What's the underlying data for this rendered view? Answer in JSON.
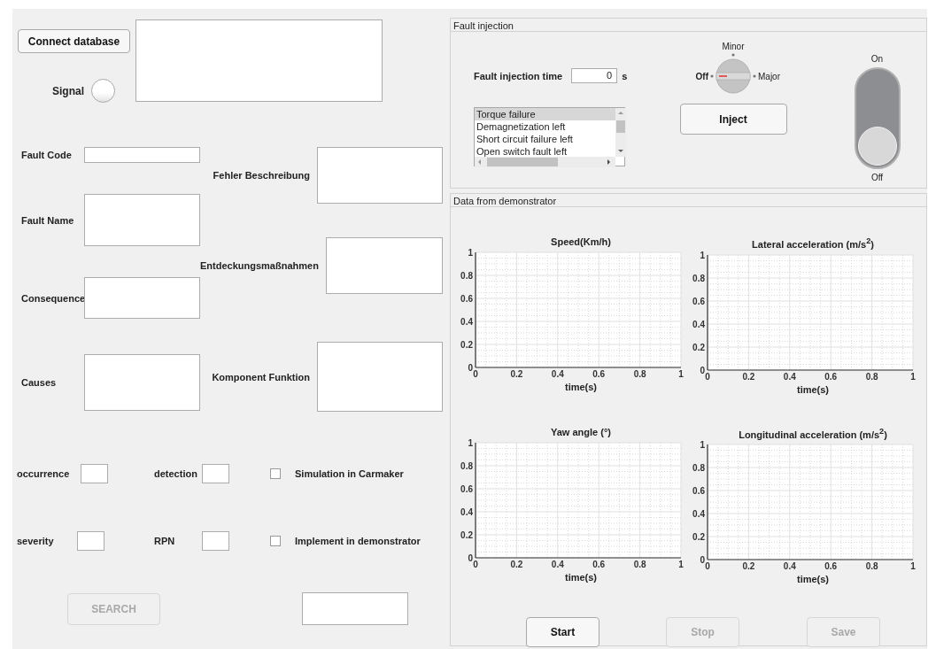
{
  "connect_button": {
    "label": "Connect database"
  },
  "signal": {
    "label": "Signal",
    "on": false
  },
  "fault_fields": [
    {
      "label": "Fault Code"
    },
    {
      "label": "Fault Name"
    },
    {
      "label": "Consequence"
    },
    {
      "label": "Causes"
    }
  ],
  "description_fields": [
    {
      "label": "Fehler Beschreibung"
    },
    {
      "label": "Entdeckungsmaßnahmen"
    },
    {
      "label": "Komponent Funktion"
    }
  ],
  "scores": [
    {
      "label": "occurrence"
    },
    {
      "label": "detection"
    },
    {
      "label": "severity"
    },
    {
      "label": "RPN"
    }
  ],
  "options": [
    {
      "label": "Simulation in Carmaker",
      "checked": false
    },
    {
      "label": "Implement in demonstrator",
      "checked": false
    }
  ],
  "search_button": {
    "label": "SEARCH",
    "disabled": true
  },
  "fault_injection": {
    "title": "Fault injection",
    "time_label": "Fault injection time",
    "time_value": "0",
    "time_unit": "s",
    "faults": [
      {
        "label": "Torque failure",
        "selected": true
      },
      {
        "label": "Demagnetization left",
        "selected": false
      },
      {
        "label": "Short circuit failure left",
        "selected": false
      },
      {
        "label": "Open switch fault left",
        "selected": false
      }
    ],
    "severity_knob": [
      {
        "label": "Off",
        "selected": true
      },
      {
        "label": "Minor",
        "selected": false
      },
      {
        "label": "Major",
        "selected": false
      }
    ],
    "inject_button": {
      "label": "Inject"
    },
    "switch": {
      "on_label": "On",
      "off_label": "Off",
      "on": false
    }
  },
  "data_panel": {
    "title": "Data from demonstrator",
    "charts": [
      {
        "chart_data": {
          "type": "line",
          "grid": true,
          "title": "Speed(Km/h)",
          "xlabel": "time(s)",
          "xlim": [
            0,
            1
          ],
          "ylim": [
            0,
            1
          ],
          "xticks": [
            0,
            0.2,
            0.4,
            0.6,
            0.8,
            1
          ],
          "yticks": [
            0,
            0.2,
            0.4,
            0.6,
            0.8,
            1
          ]
        }
      },
      {
        "chart_data": {
          "type": "line",
          "grid": true,
          "title": "Lateral  acceleration  (m/s$^{2}$)",
          "xlabel": "time(s)",
          "xlim": [
            0,
            1
          ],
          "ylim": [
            0,
            1
          ],
          "xticks": [
            0,
            0.2,
            0.4,
            0.6,
            0.8,
            1
          ],
          "yticks": [
            0,
            0.2,
            0.4,
            0.6,
            0.8,
            1
          ]
        }
      },
      {
        "chart_data": {
          "type": "line",
          "grid": true,
          "title": "Yaw angle (°)",
          "xlabel": "time(s)",
          "xlim": [
            0,
            1
          ],
          "ylim": [
            0,
            1
          ],
          "xticks": [
            0,
            0.2,
            0.4,
            0.6,
            0.8,
            1
          ],
          "yticks": [
            0,
            0.2,
            0.4,
            0.6,
            0.8,
            1
          ]
        }
      },
      {
        "chart_data": {
          "type": "line",
          "grid": true,
          "title": "Longitudinal  acceleration  (m/s$^{2}$)",
          "xlabel": "time(s)",
          "xlim": [
            0,
            1
          ],
          "ylim": [
            0,
            1
          ],
          "xticks": [
            0,
            0.2,
            0.4,
            0.6,
            0.8,
            1
          ],
          "yticks": [
            0,
            0.2,
            0.4,
            0.6,
            0.8,
            1
          ]
        }
      }
    ],
    "buttons": [
      {
        "label": "Start",
        "disabled": false
      },
      {
        "label": "Stop",
        "disabled": true
      },
      {
        "label": "Save",
        "disabled": true
      }
    ]
  }
}
